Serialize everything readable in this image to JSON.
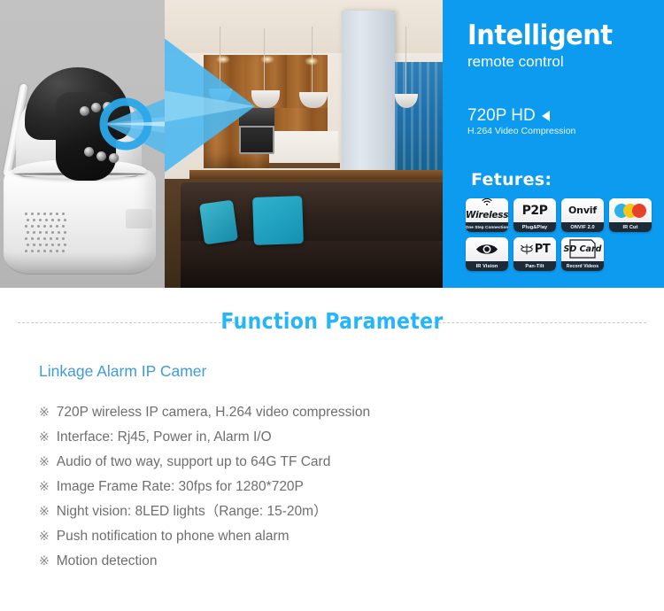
{
  "banner": {
    "product_photo": {
      "alt_name": "wireless-pan-tilt-ip-camera",
      "background_color": "#bdbdbd",
      "beam_color": "#4cb8f0"
    },
    "scene_photo": {
      "alt_name": "modern-living-room-with-dark-sofa-and-teal-pillows"
    },
    "blue_panel": {
      "background_color": "#0d9bf0",
      "title": "Intelligent",
      "subtitle": "remote control",
      "resolution": "720P HD",
      "resolution_caption": "H.264 Video Compression",
      "features_heading": "Fetures:",
      "badges": [
        {
          "top_text": "Wireless",
          "bottom_text": "One Step Connection",
          "icon": "wifi-icon"
        },
        {
          "top_text": "P2P",
          "bottom_text": "Plug&Play",
          "icon": "p2p-icon"
        },
        {
          "top_text": "Onvif",
          "bottom_text": "ONVIF 2.0",
          "icon": "onvif-icon"
        },
        {
          "top_text": "",
          "bottom_text": "IR Cut",
          "icon": "ir-cut-color-dots-icon"
        },
        {
          "top_text": "",
          "bottom_text": "IR Vision",
          "icon": "eye-icon"
        },
        {
          "top_text": "PT",
          "bottom_text": "Pan-Tilt",
          "icon": "pan-tilt-icon"
        },
        {
          "top_text": "SD Card",
          "bottom_text": "Record Videos",
          "icon": "sd-card-icon"
        }
      ]
    }
  },
  "function_parameter": {
    "title": "Function Parameter",
    "title_color": "#25b5fa",
    "section_title": "Linkage Alarm IP Camer",
    "section_title_color": "#3e9bdc",
    "bullet_mark": "※",
    "specs": [
      "720P wireless IP camera, H.264 video compression",
      "Interface: Rj45, Power in, Alarm I/O",
      "Audio of two way, support up to 64G TF Card",
      "Image Frame Rate: 30fps for 1280*720P",
      "Night vision: 8LED lights（Range: 15-20m）",
      "Push notification to phone when alarm",
      "Motion detection"
    ]
  }
}
